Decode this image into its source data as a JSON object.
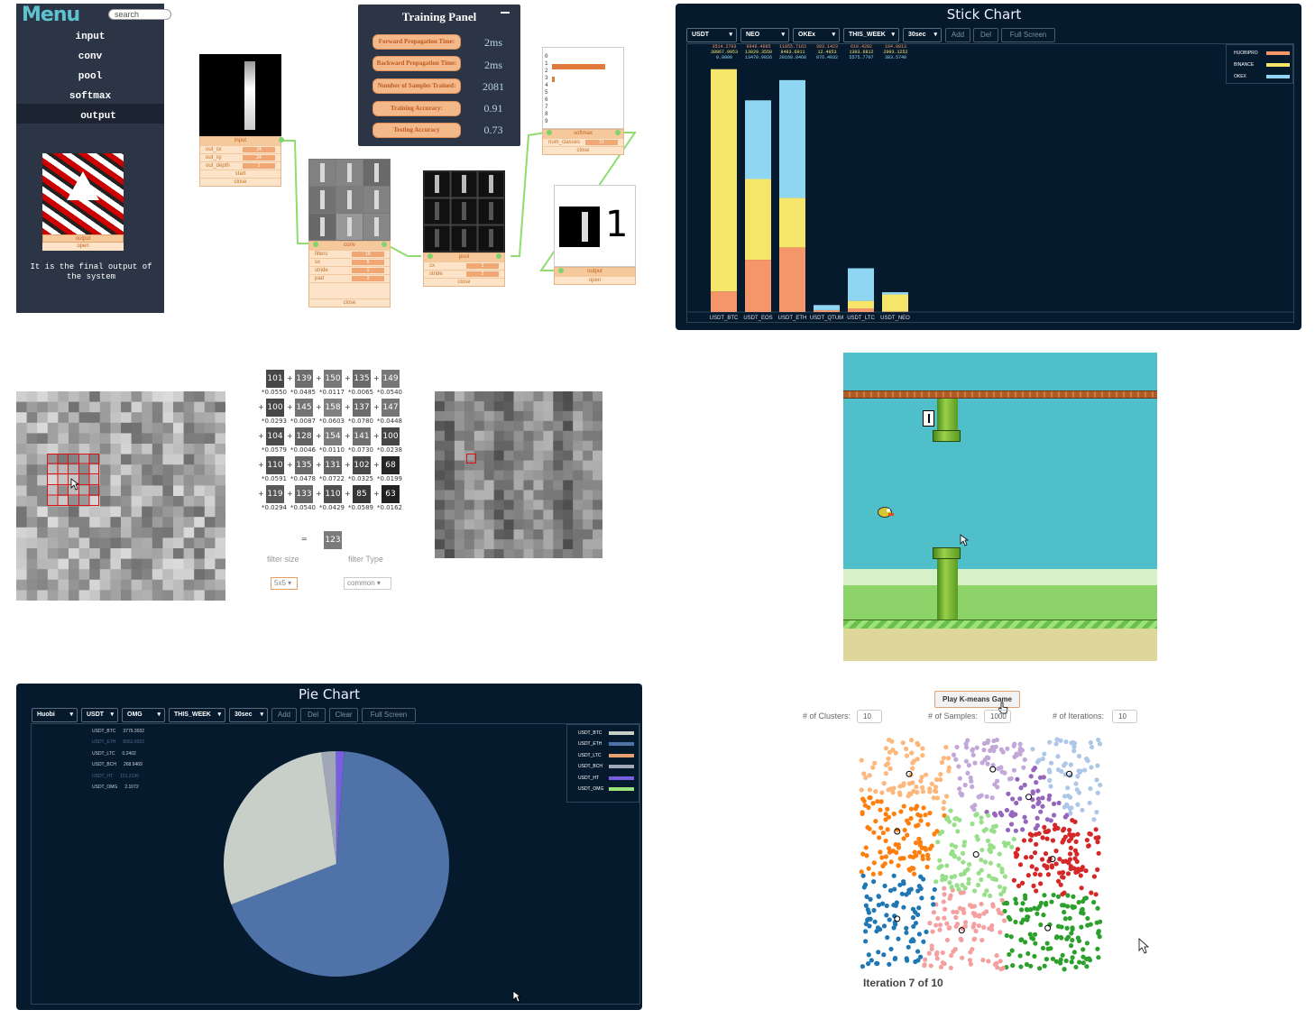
{
  "cnn": {
    "menu": {
      "title": "Menu",
      "search_placeholder": "search",
      "items": [
        "input",
        "conv",
        "pool",
        "softmax",
        "output"
      ],
      "selected": "output",
      "image_output_label": "output",
      "image_open_label": "open",
      "caption": "It is the final output of the system"
    },
    "input_node": {
      "header": "input",
      "rows": [
        {
          "label": "out_sx",
          "value": "24"
        },
        {
          "label": "out_sy",
          "value": "24"
        },
        {
          "label": "out_depth",
          "value": "1"
        }
      ],
      "start": "start",
      "close": "close"
    },
    "conv_node": {
      "header": "conv",
      "rows": [
        {
          "label": "filters",
          "value": "16"
        },
        {
          "label": "sx",
          "value": "5"
        },
        {
          "label": "stride",
          "value": "1"
        },
        {
          "label": "pad",
          "value": "2"
        }
      ],
      "close": "close"
    },
    "pool_node": {
      "header": "pool",
      "rows": [
        {
          "label": "sx",
          "value": "2"
        },
        {
          "label": "stride",
          "value": "2"
        }
      ],
      "close": "close"
    },
    "softmax_node": {
      "header": "softmax",
      "rows": [
        {
          "label": "num_classes",
          "value": "10"
        }
      ],
      "close": "close",
      "digits": [
        "0",
        "1",
        "2",
        "3",
        "4",
        "5",
        "6",
        "7",
        "8",
        "9"
      ]
    },
    "output_node": {
      "header": "output",
      "open": "open",
      "prediction": "1"
    },
    "training_panel": {
      "title": "Training Panel",
      "rows": [
        {
          "label": "Forward Propagation Time:",
          "value": "2ms"
        },
        {
          "label": "Backward Propagation Time:",
          "value": "2ms"
        },
        {
          "label": "Number of Samples Trained:",
          "value": "2081"
        },
        {
          "label": "Training Accuracy:",
          "value": "0.91"
        },
        {
          "label": "Testing Accuracy",
          "value": "0.73"
        }
      ]
    }
  },
  "stick": {
    "title": "Stick Chart",
    "controls": [
      "USDT",
      "NEO",
      "OKEx",
      "THIS_WEEK",
      "30sec"
    ],
    "buttons": [
      "Add",
      "Del",
      "Full Screen"
    ],
    "stats": [
      {
        "a": "3514.2703",
        "b": "38067.9953",
        "c": "0.0000"
      },
      {
        "a": "8946.4085",
        "b": "13829.3550",
        "c": "13470.9026"
      },
      {
        "a": "11055.7163",
        "b": "8483.6911",
        "c": "20168.8468"
      },
      {
        "a": "303.1423",
        "b": "12.4953",
        "c": "876.4032"
      },
      {
        "a": "610.4292",
        "b": "1303.6812",
        "c": "5575.7707"
      },
      {
        "a": "104.0813",
        "b": "2903.1252",
        "c": "383.5740"
      }
    ],
    "legend": [
      "HUOBIPRO",
      "BINANCE",
      "OKEX"
    ],
    "colors": {
      "HUOBIPRO": "#f4956a",
      "BINANCE": "#f5e56b",
      "OKEX": "#8fd6f2"
    }
  },
  "conv_demo": {
    "rows": [
      {
        "values": [
          "101",
          "139",
          "150",
          "135",
          "149"
        ],
        "weights": [
          "*0.0550",
          "*0.0485",
          "*0.0117",
          "*0.0065",
          "*0.0540"
        ]
      },
      {
        "values": [
          "100",
          "145",
          "158",
          "137",
          "147"
        ],
        "weights": [
          "*0.0293",
          "*0.0087",
          "*0.0603",
          "*0.0780",
          "*0.0448"
        ]
      },
      {
        "values": [
          "104",
          "128",
          "154",
          "141",
          "100"
        ],
        "weights": [
          "*0.0579",
          "*0.0046",
          "*0.0110",
          "*0.0730",
          "*0.0238"
        ]
      },
      {
        "values": [
          "110",
          "135",
          "131",
          "102",
          "68"
        ],
        "weights": [
          "*0.0591",
          "*0.0478",
          "*0.0722",
          "*0.0325",
          "*0.0199"
        ]
      },
      {
        "values": [
          "119",
          "133",
          "110",
          "85",
          "63"
        ],
        "weights": [
          "*0.0294",
          "*0.0540",
          "*0.0429",
          "*0.0589",
          "*0.0162"
        ]
      }
    ],
    "equals": "=",
    "result": "123",
    "filter_size_label": "filter size",
    "filter_type_label": "filter Type",
    "filter_size_value": "5x5",
    "filter_type_value": "common"
  },
  "pie": {
    "title": "Pie Chart",
    "controls": [
      "Huobi",
      "USDT",
      "OMG",
      "THIS_WEEK",
      "30sec"
    ],
    "buttons": [
      "Add",
      "Del",
      "Clear",
      "Full Screen"
    ],
    "stats": [
      {
        "name": "USDT_BTC",
        "value": "3776.3932"
      },
      {
        "name": "USDT_ETH",
        "value": "8952.9922"
      },
      {
        "name": "USDT_LTC",
        "value": "0.2402"
      },
      {
        "name": "USDT_BCH",
        "value": "268.9469"
      },
      {
        "name": "USDT_HT",
        "value": "151.2136"
      },
      {
        "name": "USDT_OMG",
        "value": "2.1072"
      }
    ],
    "legend": [
      {
        "name": "USDT_BTC",
        "color": "#c8cfc8"
      },
      {
        "name": "USDT_ETH",
        "color": "#4f73a8"
      },
      {
        "name": "USDT_LTC",
        "color": "#e8a070"
      },
      {
        "name": "USDT_BCH",
        "color": "#a0a8b8"
      },
      {
        "name": "USDT_HT",
        "color": "#7a5ee0"
      },
      {
        "name": "USDT_OMG",
        "color": "#9be27a"
      }
    ]
  },
  "kmeans": {
    "button": "Play K-means Game",
    "clusters_label": "# of Clusters:",
    "clusters_value": "10",
    "samples_label": "# of Samples:",
    "samples_value": "1000",
    "iterations_label": "# of Iterations:",
    "iterations_value": "10",
    "status": "Iteration 7 of 10"
  },
  "chart_data": [
    {
      "type": "bar",
      "title": "Stick Chart",
      "categories": [
        "USDT_BTC",
        "USDT_EOS",
        "USDT_ETH",
        "USDT_QTUM",
        "USDT_LTC",
        "USDT_NEO"
      ],
      "stacked": true,
      "series": [
        {
          "name": "HUOBIPRO",
          "values": [
            3514.27,
            8946.41,
            11055.72,
            303.14,
            610.43,
            104.08
          ]
        },
        {
          "name": "BINANCE",
          "values": [
            38067.99,
            13829.36,
            8483.69,
            12.5,
            1303.68,
            2903.13
          ]
        },
        {
          "name": "OKEX",
          "values": [
            0,
            13470.9,
            20168.85,
            876.4,
            5575.77,
            383.57
          ]
        }
      ],
      "ylim": [
        0,
        42000
      ],
      "legend": "top-right"
    },
    {
      "type": "pie",
      "title": "Pie Chart",
      "labels": [
        "USDT_BTC",
        "USDT_ETH",
        "USDT_LTC",
        "USDT_BCH",
        "USDT_HT",
        "USDT_OMG"
      ],
      "values": [
        3776.3932,
        8952.9922,
        0.2402,
        268.9469,
        151.2136,
        2.1072
      ],
      "legend": "top-right"
    },
    {
      "type": "scatter",
      "title": "",
      "clusters": 10,
      "samples": 1000,
      "centroids": [
        [
          0.2,
          0.85
        ],
        [
          0.55,
          0.87
        ],
        [
          0.7,
          0.75
        ],
        [
          0.87,
          0.85
        ],
        [
          0.15,
          0.6
        ],
        [
          0.48,
          0.5
        ],
        [
          0.8,
          0.48
        ],
        [
          0.15,
          0.22
        ],
        [
          0.42,
          0.17
        ],
        [
          0.78,
          0.18
        ]
      ],
      "cluster_colors": [
        "#fdb77a",
        "#c2a8d8",
        "#9467bd",
        "#aec7e8",
        "#ff7f0e",
        "#98df8a",
        "#d62728",
        "#1f77b4",
        "#f5a0a0",
        "#2ca02c"
      ]
    }
  ]
}
